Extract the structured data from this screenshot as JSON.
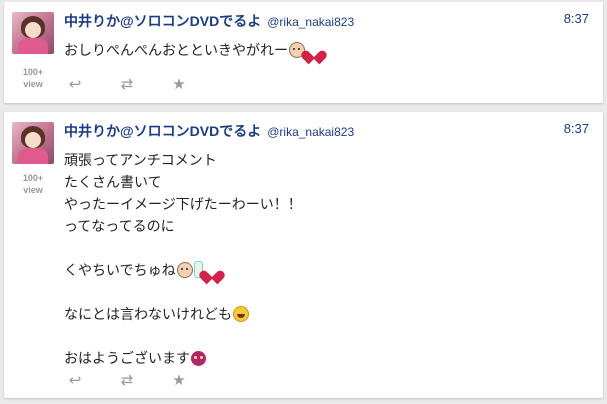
{
  "tweets": [
    {
      "name": "中井りか@ソロコンDVDでるよ",
      "handle": "@rika_nakai823",
      "time": "8:37",
      "views_count": "100+",
      "views_label": "view",
      "lines": [
        "おしりぺんぺんおとといきやがれー"
      ],
      "emoji_tail": [
        "baby-face-emoji",
        "heart-emoji"
      ]
    },
    {
      "name": "中井りか@ソロコンDVDでるよ",
      "handle": "@rika_nakai823",
      "time": "8:37",
      "views_count": "100+",
      "views_label": "view",
      "lines": [
        "頑張ってアンチコメント",
        "たくさん書いて",
        "やったーイメージ下げたーわーい！！",
        "ってなってるのに",
        "",
        "くやちいでちゅね",
        "",
        "なにとは言わないけれども",
        "",
        "おはようございます"
      ]
    }
  ],
  "actions": {
    "reply_icon": "reply-icon",
    "retweet_icon": "retweet-icon",
    "favorite_icon": "star-icon"
  }
}
